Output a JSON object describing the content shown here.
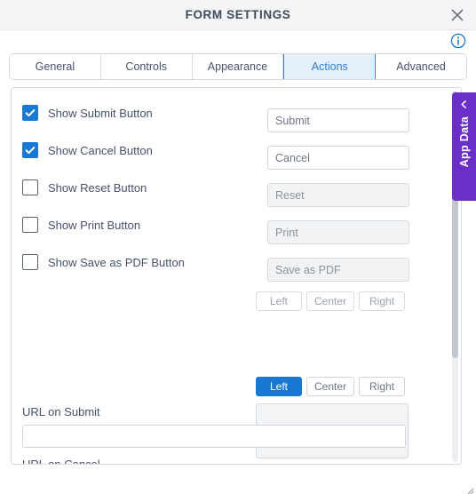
{
  "window": {
    "title": "FORM SETTINGS",
    "close_icon": "close-icon",
    "info_icon": "info-icon"
  },
  "tabs": [
    {
      "label": "General",
      "active": false
    },
    {
      "label": "Controls",
      "active": false
    },
    {
      "label": "Appearance",
      "active": false
    },
    {
      "label": "Actions",
      "active": true
    },
    {
      "label": "Advanced",
      "active": false
    }
  ],
  "checkboxes": [
    {
      "label": "Show Submit Button",
      "checked": true
    },
    {
      "label": "Show Cancel Button",
      "checked": true
    },
    {
      "label": "Show Reset Button",
      "checked": false
    },
    {
      "label": "Show Print Button",
      "checked": false
    },
    {
      "label": "Show Save as PDF Button",
      "checked": false
    }
  ],
  "button_labels": [
    {
      "value": "Submit",
      "disabled": false
    },
    {
      "value": "Cancel",
      "disabled": false
    },
    {
      "value": "Reset",
      "disabled": true
    },
    {
      "value": "Print",
      "disabled": true
    },
    {
      "value": "Save as PDF",
      "disabled": true
    }
  ],
  "align_group_top": {
    "options": [
      "Left",
      "Center",
      "Right"
    ],
    "selected": ""
  },
  "align_group_bottom": {
    "options": [
      "Left",
      "Center",
      "Right"
    ],
    "selected": "Left"
  },
  "url_fields": [
    {
      "label": "URL on Submit",
      "value": ""
    },
    {
      "label": "URL on Cancel",
      "value": ""
    }
  ],
  "app_data_tab": {
    "label": "App Data",
    "chevron_icon": "chevron-left-icon"
  },
  "colors": {
    "accent_blue": "#1878d2",
    "tab_active_bg": "#e4f0fb",
    "tab_active_text": "#2f7fd4",
    "app_data_purple": "#6b2fc9",
    "title_text": "#3f4a5a",
    "label_text": "#46526a",
    "header_bg": "#f4f4f6"
  }
}
